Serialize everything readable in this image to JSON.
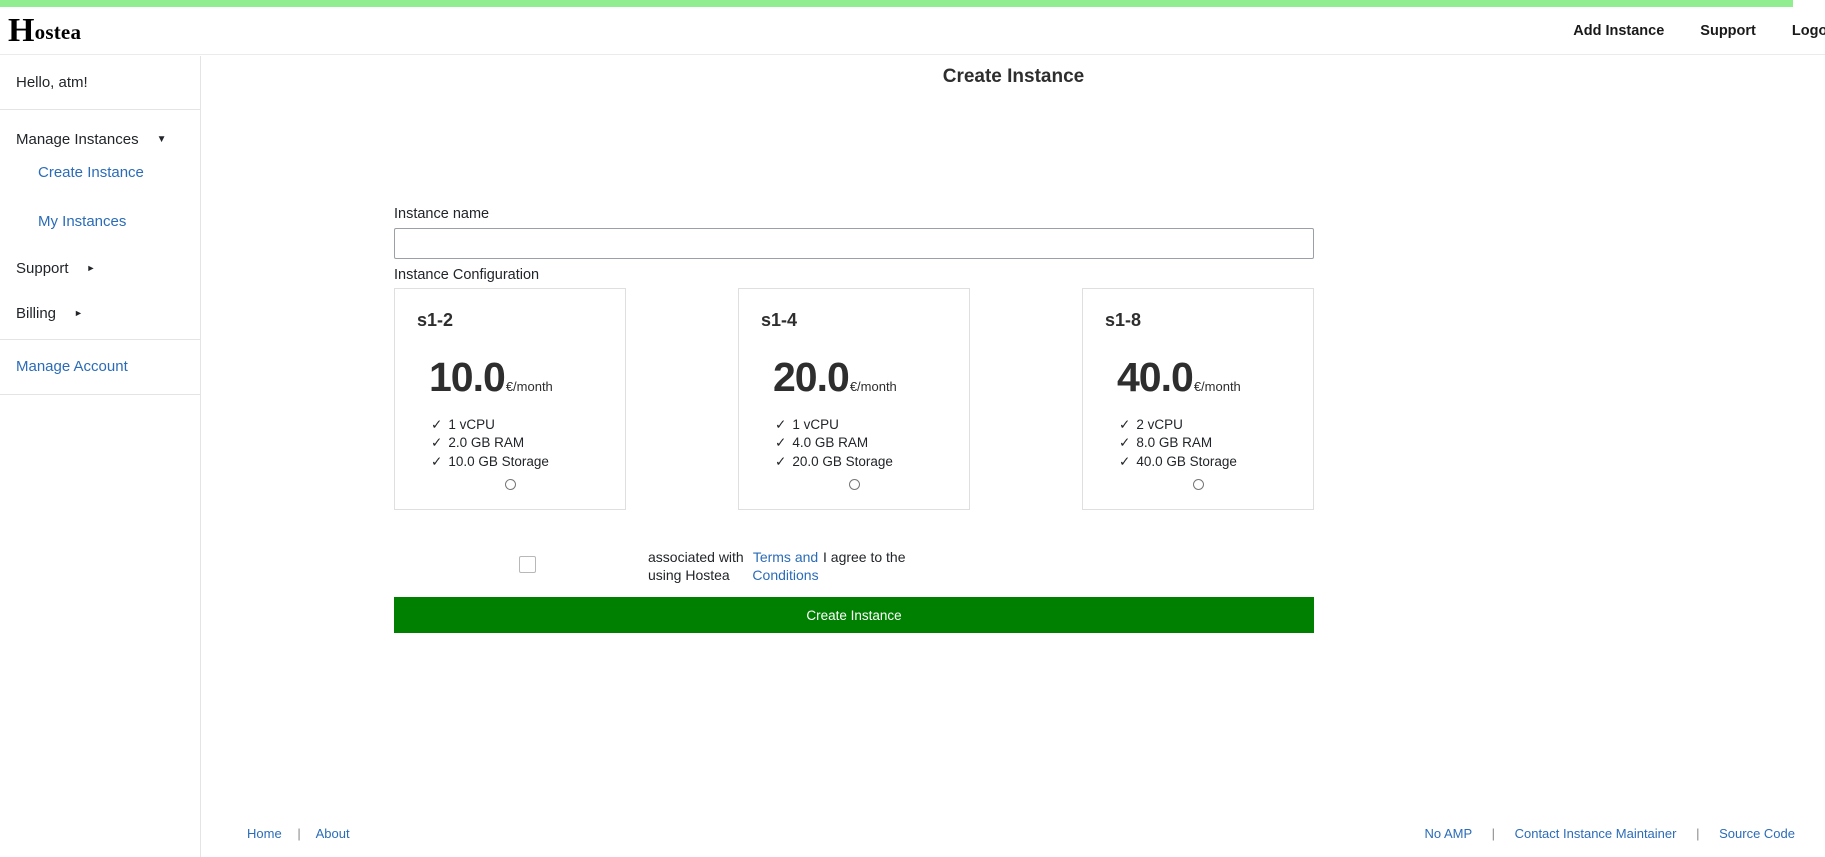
{
  "theme": {
    "accent_bar_color": "#90ee90",
    "link_color": "#2b6cb8",
    "submit_color": "#008000",
    "text_color": "#212529"
  },
  "header": {
    "brand_initial": "H",
    "brand_rest": "ostea",
    "nav": [
      {
        "label": "Add Instance"
      },
      {
        "label": "Support"
      },
      {
        "label": "Logout"
      }
    ]
  },
  "sidebar": {
    "greeting": "Hello, atm!",
    "groups": [
      {
        "label": "Manage Instances",
        "caret": "▼",
        "children": [
          {
            "label": "Create Instance"
          },
          {
            "label": "My Instances"
          }
        ]
      },
      {
        "label": "Support",
        "caret": "►"
      },
      {
        "label": "Billing",
        "caret": "►"
      }
    ],
    "account_link": "Manage Account"
  },
  "main": {
    "title": "Create Instance",
    "instance_name": {
      "label": "Instance name",
      "value": "",
      "placeholder": ""
    },
    "config_label": "Instance Configuration",
    "plans": [
      {
        "name": "s1-2",
        "price": "10.0",
        "price_unit": "€/month",
        "features": [
          "1 vCPU",
          "2.0 GB RAM",
          "10.0 GB Storage"
        ],
        "selected": false
      },
      {
        "name": "s1-4",
        "price": "20.0",
        "price_unit": "€/month",
        "features": [
          "1 vCPU",
          "4.0 GB RAM",
          "20.0 GB Storage"
        ],
        "selected": false
      },
      {
        "name": "s1-8",
        "price": "40.0",
        "price_unit": "€/month",
        "features": [
          "2 vCPU",
          "8.0 GB RAM",
          "40.0 GB Storage"
        ],
        "selected": false
      }
    ],
    "feature_tick": "✓",
    "terms": {
      "checked": false,
      "segment_1": "associated with using Hostea",
      "segment_link": "Terms and Conditions",
      "segment_2": "I agree to the"
    },
    "submit_label": "Create Instance"
  },
  "footer": {
    "left": [
      {
        "label": "Home"
      },
      {
        "label": "About"
      }
    ],
    "right": [
      {
        "label": "No AMP"
      },
      {
        "label": "Contact Instance Maintainer"
      },
      {
        "label": "Source Code"
      }
    ],
    "separator": "|"
  }
}
